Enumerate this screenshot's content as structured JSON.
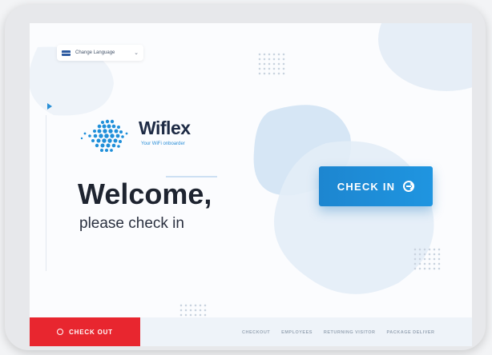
{
  "language": {
    "label": "Change Language"
  },
  "brand": {
    "name": "Wiflex",
    "tagline": "Your WiFi onboarder"
  },
  "welcome": {
    "title": "Welcome,",
    "subtitle": "please check in"
  },
  "actions": {
    "check_in": "CHECK IN",
    "check_out": "CHECK OUT"
  },
  "footer": {
    "links": [
      "CHECKOUT",
      "EMPLOYEES",
      "RETURNING VISITOR",
      "PACKAGE DELIVER"
    ]
  },
  "colors": {
    "accent": "#1d86d0",
    "danger": "#e8262f",
    "text_dark": "#1e2430"
  },
  "icons": {
    "language": "flag-icon",
    "dropdown": "chevron-down-icon",
    "check_in": "arrow-circle-right-icon",
    "check_out": "exit-icon",
    "indicator": "play-icon"
  }
}
